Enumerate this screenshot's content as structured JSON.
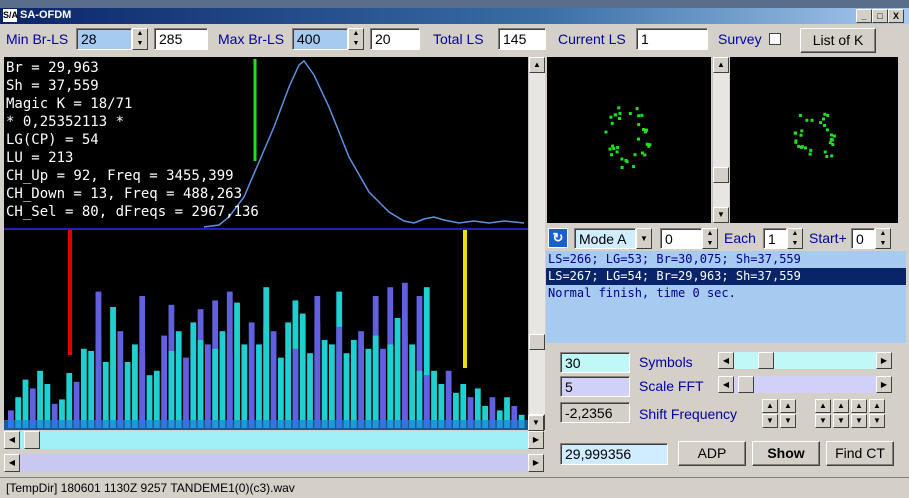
{
  "window": {
    "title": "SA-OFDM",
    "icon_text": "S/A",
    "min": "_",
    "max": "□",
    "close": "X"
  },
  "toolbar": {
    "min_br_label": "Min Br-LS",
    "min_br_value": "28",
    "min_br_value2": "285",
    "max_br_label": "Max Br-LS",
    "max_br_value": "400",
    "max_br_value2": "20",
    "total_ls_label": "Total LS",
    "total_ls_value": "145",
    "current_ls_label": "Current LS",
    "current_ls_value": "1",
    "survey_label": "Survey",
    "list_k_label": "List of K"
  },
  "info": [
    "Br = 29,963",
    "Sh = 37,559",
    "Magic K = 18/71",
    "* 0,25352113 *",
    "LG(CP) = 54",
    "LU = 213",
    "CH_Up = 92, Freq = 3455,399",
    "CH_Down = 13, Freq = 488,263",
    "CH_Sel = 80, dFreqs = 2967,136"
  ],
  "mode": {
    "value": "Mode A",
    "offset": "0",
    "each_label": "Each",
    "each_value": "1",
    "start_label": "Start+",
    "start_value": "0"
  },
  "log": [
    "LS=266; LG=53; Br=30,075; Sh=37,559",
    "LS=267; LG=54; Br=29,963; Sh=37,559",
    "Normal finish, time 0 sec."
  ],
  "controls": {
    "symbols_value": "30",
    "symbols_label": "Symbols",
    "scale_fft_value": "5",
    "scale_fft_label": "Scale FFT",
    "shift_value": "-2,2356",
    "shift_label": "Shift Frequency",
    "freq_value": "29,999356",
    "adp_label": "ADP",
    "show_label": "Show",
    "find_ct_label": "Find CT"
  },
  "status": {
    "text": "[TempDir] 180601 1130Z 9257 TANDEME1(0)(c3).wav"
  },
  "colors": {
    "spectrum_dark": "#6060e0",
    "spectrum_light": "#20d0d0",
    "marker_red": "#e00000",
    "marker_yellow": "#f0e000",
    "marker_green": "#20e020",
    "curve": "#6090e0"
  },
  "chart_data": {
    "type": "bar",
    "bars": [
      8,
      14,
      22,
      18,
      26,
      20,
      11,
      13,
      25,
      21,
      36,
      35,
      42,
      30,
      55,
      44,
      30,
      38,
      33,
      24,
      26,
      42,
      35,
      44,
      32,
      48,
      40,
      38,
      36,
      44,
      34,
      57,
      38,
      48,
      38,
      46,
      44,
      32,
      48,
      36,
      52,
      34,
      48,
      40,
      38,
      46,
      34,
      40,
      44,
      36,
      42,
      36,
      38,
      50,
      42,
      38,
      26,
      24,
      26,
      20,
      26,
      16,
      20,
      14,
      18,
      10,
      14,
      8,
      14,
      10,
      6
    ],
    "tall_bars": [
      0,
      0,
      0,
      0,
      0,
      0,
      0,
      0,
      0,
      0,
      0,
      0,
      62,
      0,
      0,
      0,
      0,
      0,
      60,
      0,
      0,
      0,
      56,
      0,
      0,
      0,
      54,
      0,
      58,
      0,
      62,
      0,
      0,
      0,
      0,
      64,
      0,
      0,
      0,
      58,
      0,
      0,
      60,
      0,
      0,
      62,
      0,
      0,
      0,
      0,
      60,
      0,
      64,
      0,
      66,
      0,
      60,
      64,
      0,
      0,
      0,
      0,
      0,
      0,
      0,
      0,
      0,
      0,
      0,
      0,
      0
    ]
  }
}
